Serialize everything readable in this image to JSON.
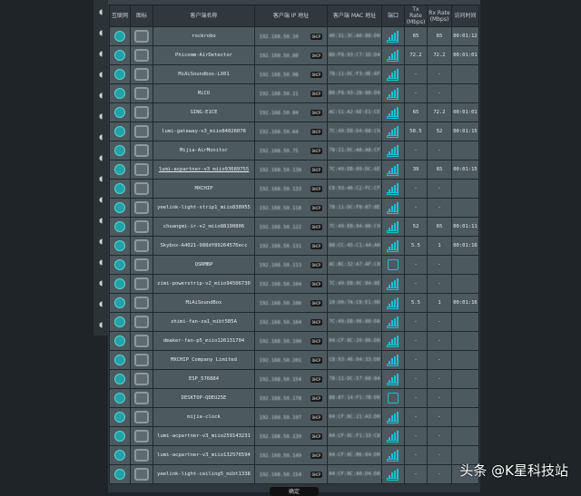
{
  "headers": [
    "互联网",
    "图标",
    "客户端名称",
    "客户端 IP 地址",
    "客户端 MAC 地址",
    "端口",
    "Tx Rate (Mbps)",
    "Rx Rate (Mbps)",
    "访问时间"
  ],
  "dhcp_label": "DHCP",
  "ok_button": "确定",
  "watermark": "头条 @K星科技站",
  "rows": [
    {
      "name": "rockrobo",
      "ip": "192.168.50.10",
      "mac": "40:31:3C:A0:88:D0",
      "port": "wifi",
      "tx": "65",
      "rx": "65",
      "time": "00:01:12"
    },
    {
      "name": "Phicomm-AirDetector",
      "ip": "192.168.50.80",
      "mac": "B0:F8:93:C7:1D:D4",
      "port": "wifi",
      "tx": "72.2",
      "rx": "72.2",
      "time": "00:01:01"
    },
    {
      "name": "MiAiSoundbox-LX01",
      "ip": "192.168.50.98",
      "mac": "78:11:DC:F3:9E:6F",
      "port": "wifi",
      "tx": "-",
      "rx": "-",
      "time": ""
    },
    {
      "name": "MiCO",
      "ip": "192.168.50.11",
      "mac": "B0:F8:93:2B:88:D9",
      "port": "wifi",
      "tx": "-",
      "rx": "-",
      "time": ""
    },
    {
      "name": "SING-E1CE",
      "ip": "192.168.50.84",
      "mac": "AC:11:A2:6E:E1:CE",
      "port": "wifi",
      "tx": "65",
      "rx": "72.2",
      "time": "00:01:01"
    },
    {
      "name": "lumi-gateway-v3_miio84026078",
      "ip": "192.168.50.64",
      "mac": "7C:49:EB:D4:88:C9",
      "port": "wifi",
      "tx": "58.5",
      "rx": "52",
      "time": "00:01:15"
    },
    {
      "name": "Mijia-AirMonitor",
      "ip": "192.168.50.75",
      "mac": "78:11:DC:A8:A8:CF",
      "port": "wifi",
      "tx": "-",
      "rx": "-",
      "time": ""
    },
    {
      "name": "lumi-acpartner-v3_miio93689755",
      "ip": "192.168.50.138",
      "mac": "7C:49:EB:09:DC:6E",
      "port": "wifi",
      "tx": "39",
      "rx": "65",
      "time": "00:01:15",
      "link": true
    },
    {
      "name": "MXCHIP",
      "ip": "192.168.50.133",
      "mac": "C8:93:46:C2:FC:CF",
      "port": "wifi",
      "tx": "-",
      "rx": "-",
      "time": ""
    },
    {
      "name": "yeelink-light-strip1_miio838955",
      "ip": "192.168.50.118",
      "mac": "78:11:DC:F8:87:8E",
      "port": "wifi",
      "tx": "-",
      "rx": "-",
      "time": ""
    },
    {
      "name": "chuangmi-ir-v2_miio88190806",
      "ip": "192.168.50.122",
      "mac": "7C:49:EB:94:88:C9",
      "port": "wifi",
      "tx": "52",
      "rx": "65",
      "time": "00:01:11"
    },
    {
      "name": "Skybox-A4021-988df89264576ecc",
      "ip": "192.168.50.131",
      "mac": "88:CC:45:C1:44:A0",
      "port": "wifi",
      "tx": "5.5",
      "rx": "1",
      "time": "00:01:16"
    },
    {
      "name": "QSRMBP",
      "ip": "192.168.50.113",
      "mac": "AC:BC:32:A7:AF:C8",
      "port": "wired",
      "tx": "-",
      "rx": "-",
      "time": ""
    },
    {
      "name": "zimi-powerstrip-v2_miio94506730",
      "ip": "192.168.50.104",
      "mac": "7C:49:EB:0C:84:8E",
      "port": "wifi",
      "tx": "-",
      "rx": "-",
      "time": ""
    },
    {
      "name": "MiAiSoundBox",
      "ip": "192.168.50.106",
      "mac": "10:D0:7A:C8:E1:0D",
      "port": "wifi",
      "tx": "5.5",
      "rx": "1",
      "time": "00:01:16"
    },
    {
      "name": "zhimi-fan-za1_mibt5B5A",
      "ip": "192.168.50.104",
      "mac": "7C:49:EB:06:88:DA",
      "port": "wifi",
      "tx": "-",
      "rx": "-",
      "time": ""
    },
    {
      "name": "dmaker-fan-p5_miio126131704",
      "ip": "192.168.50.190",
      "mac": "04:CF:8C:20:86:D8",
      "port": "wifi",
      "tx": "-",
      "rx": "-",
      "time": ""
    },
    {
      "name": "MXCHIP Company Limited",
      "ip": "192.168.50.201",
      "mac": "C8:93:46:04:33:D0",
      "port": "wifi",
      "tx": "-",
      "rx": "-",
      "time": ""
    },
    {
      "name": "ESP_576884",
      "ip": "192.168.50.154",
      "mac": "78:11:DC:57:68:84",
      "port": "wifi",
      "tx": "-",
      "rx": "-",
      "time": ""
    },
    {
      "name": "DESKTOP-QDEU25E",
      "ip": "192.168.50.178",
      "mac": "88:87:14:F1:7B:D0",
      "port": "wired",
      "tx": "-",
      "rx": "-",
      "time": ""
    },
    {
      "name": "mijia-clock",
      "ip": "192.168.50.197",
      "mac": "04:CF:8C:21:A3:D0",
      "port": "wifi",
      "tx": "-",
      "rx": "-",
      "time": ""
    },
    {
      "name": "lumi-acpartner-v3_miio259143231",
      "ip": "192.168.50.139",
      "mac": "04:CF:8C:F1:33:C8",
      "port": "wifi",
      "tx": "-",
      "rx": "-",
      "time": ""
    },
    {
      "name": "lumi-acpartner-v3_miio132576594",
      "ip": "192.168.50.149",
      "mac": "04:CF:8C:B6:84:D0",
      "port": "wifi",
      "tx": "-",
      "rx": "-",
      "time": ""
    },
    {
      "name": "yeelink-light-ceiling5_mibt1338",
      "ip": "192.168.50.154",
      "mac": "04:CF:8C:A0:D4:D8",
      "port": "wifi",
      "tx": "-",
      "rx": "-",
      "time": ""
    }
  ]
}
